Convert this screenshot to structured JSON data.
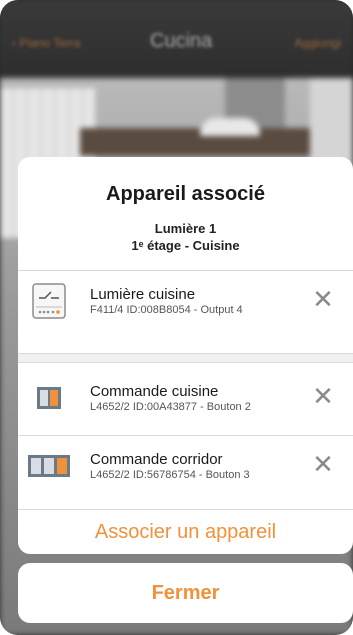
{
  "background": {
    "back_label": "‹ Piano Terra",
    "title": "Cucina",
    "add_label": "Aggiungi"
  },
  "dialog": {
    "title": "Appareil associé",
    "subtitle_line1": "Lumière 1",
    "subtitle_line2": "1ᵉ étage - Cuisine",
    "devices": [
      {
        "name": "Lumière cuisine",
        "details": "F411/4 ID:008B8054 - Output 4",
        "icon": "actuator-icon"
      },
      {
        "name": "Commande cuisine",
        "details": "L4652/2 ID:00A43877 - Bouton 2",
        "icon": "double-switch-icon"
      },
      {
        "name": "Commande corridor",
        "details": "L4652/2 ID:56786754 - Bouton 3",
        "icon": "triple-switch-icon"
      }
    ],
    "remove_symbol": "✕",
    "associate_label": "Associer un appareil",
    "close_label": "Fermer"
  },
  "colors": {
    "accent": "#f0913b",
    "remove": "#8a8a8a"
  }
}
